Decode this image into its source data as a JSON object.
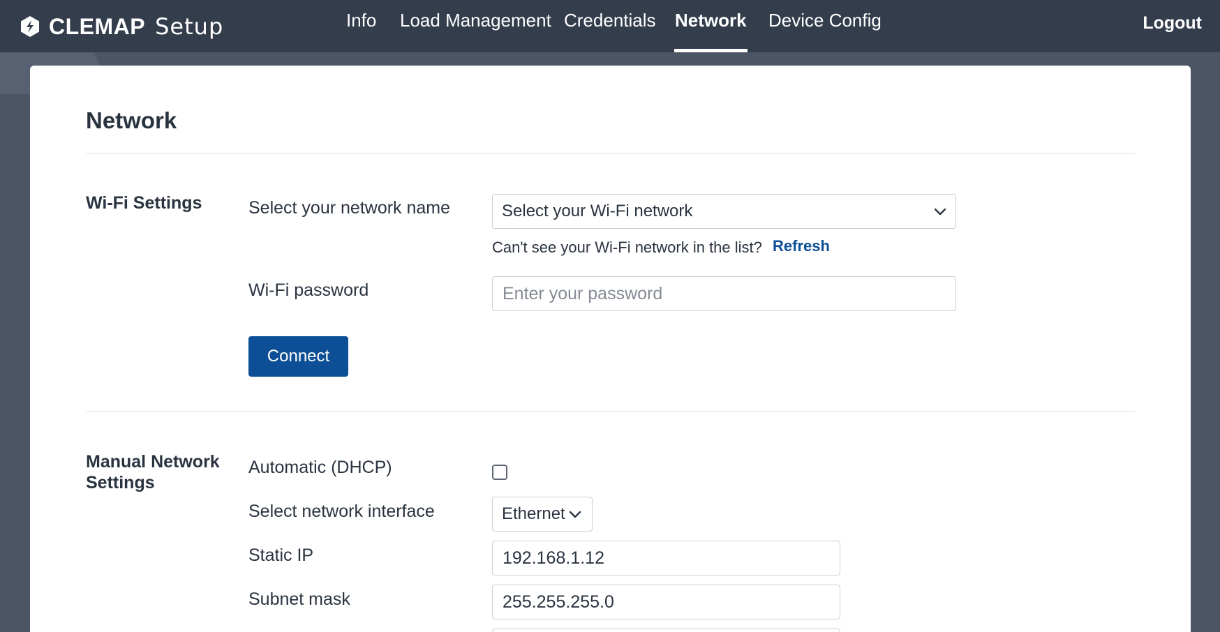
{
  "header": {
    "brand_name": "CLEMAP",
    "brand_suffix": "Setup",
    "nav": [
      {
        "label": "Info",
        "active": false
      },
      {
        "label": "Load Management",
        "active": false
      },
      {
        "label": "Credentials",
        "active": false
      },
      {
        "label": "Network",
        "active": true
      },
      {
        "label": "Device Config",
        "active": false
      }
    ],
    "logout_label": "Logout"
  },
  "page": {
    "title": "Network"
  },
  "wifi": {
    "section_title": "Wi-Fi Settings",
    "network_label": "Select your network name",
    "network_select_value": "Select your Wi-Fi network",
    "hint": "Can't see your Wi-Fi network in the list?",
    "refresh_label": "Refresh",
    "password_label": "Wi-Fi password",
    "password_placeholder": "Enter your password",
    "connect_label": "Connect"
  },
  "manual": {
    "section_title_line1": "Manual Network",
    "section_title_line2": "Settings",
    "dhcp_label": "Automatic (DHCP)",
    "dhcp_checked": false,
    "interface_label": "Select network interface",
    "interface_value": "Ethernet",
    "static_ip_label": "Static IP",
    "static_ip_value": "192.168.1.12",
    "subnet_label": "Subnet mask",
    "subnet_value": "255.255.255.0"
  },
  "colors": {
    "header_bg": "#333d4b",
    "page_bg": "#4c5564",
    "primary": "#0d4f96",
    "text": "#2a3340"
  }
}
